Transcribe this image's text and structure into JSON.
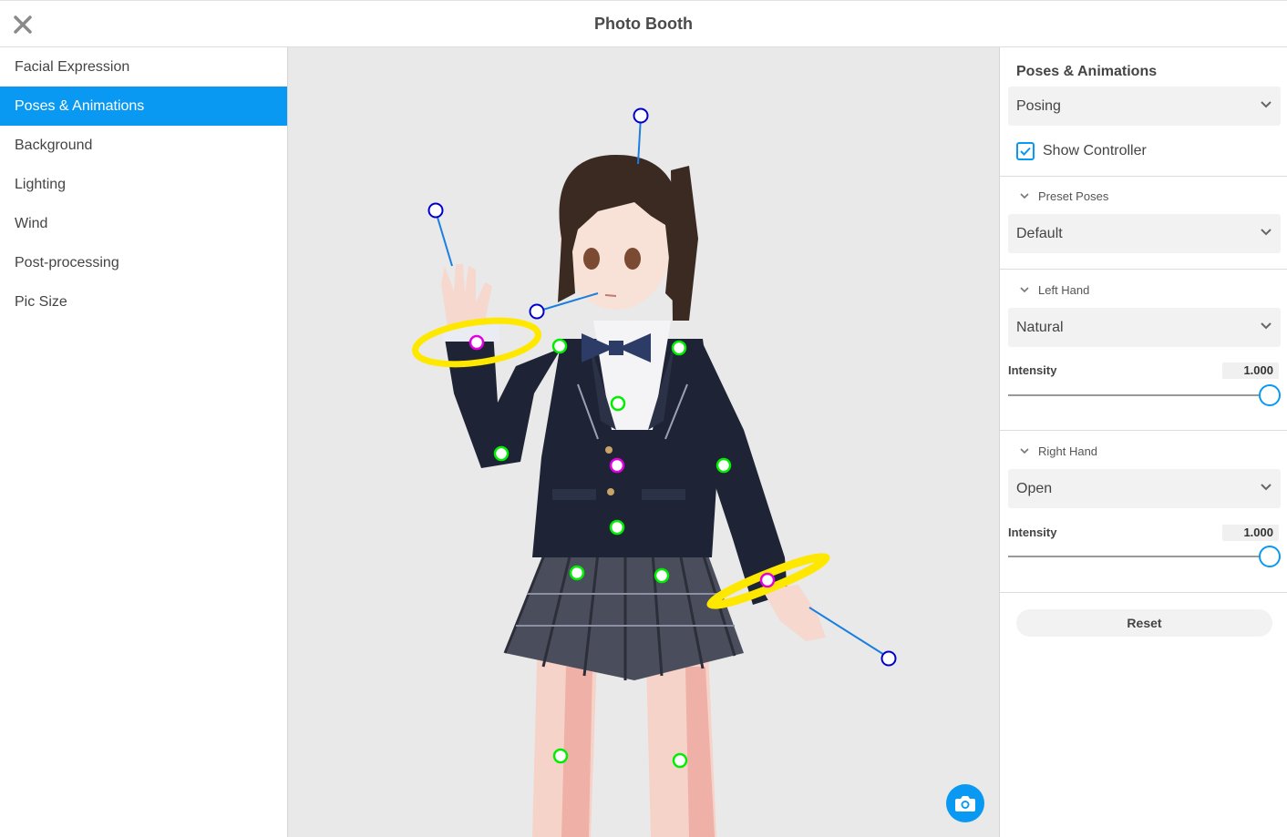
{
  "header": {
    "title": "Photo Booth",
    "close_icon": "close-icon"
  },
  "sidebar": {
    "items": [
      {
        "label": "Facial Expression",
        "active": false
      },
      {
        "label": "Poses & Animations",
        "active": true
      },
      {
        "label": "Background",
        "active": false
      },
      {
        "label": "Lighting",
        "active": false
      },
      {
        "label": "Wind",
        "active": false
      },
      {
        "label": "Post-processing",
        "active": false
      },
      {
        "label": "Pic Size",
        "active": false
      }
    ]
  },
  "panel": {
    "title": "Poses & Animations",
    "mode_select": "Posing",
    "show_controller": {
      "label": "Show Controller",
      "checked": true
    },
    "preset_poses": {
      "label": "Preset Poses",
      "value": "Default"
    },
    "left_hand": {
      "label": "Left Hand",
      "value": "Natural",
      "intensity_label": "Intensity",
      "intensity": "1.000",
      "intensity_fraction": 1.0
    },
    "right_hand": {
      "label": "Right Hand",
      "value": "Open",
      "intensity_label": "Intensity",
      "intensity": "1.000",
      "intensity_fraction": 1.0
    },
    "reset_label": "Reset"
  },
  "viewport": {
    "camera_icon": "camera-icon"
  },
  "colors": {
    "accent": "#0a99f2",
    "controller_green": "#00ee00",
    "controller_magenta": "#e100e1",
    "controller_blue": "#0000cc",
    "ring_yellow": "#ffe800"
  }
}
